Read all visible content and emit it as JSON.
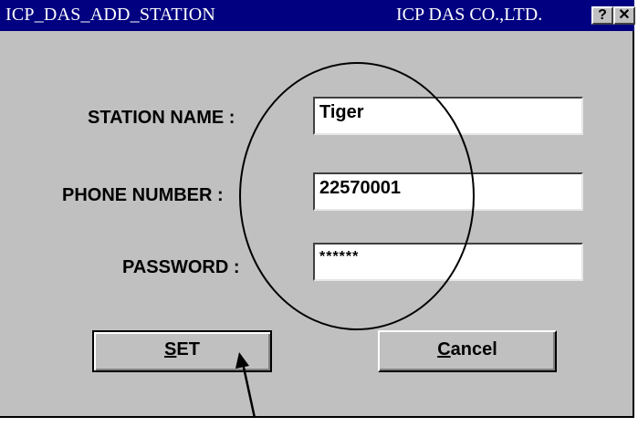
{
  "window": {
    "title": "ICP_DAS_ADD_STATION",
    "company": "ICP DAS CO.,LTD.",
    "help_label": "?",
    "close_label": "✕"
  },
  "form": {
    "station_name_label": "STATION NAME :",
    "station_name_value": "Tiger",
    "phone_number_label": "PHONE NUMBER :",
    "phone_number_value": "22570001",
    "password_label": "PASSWORD :",
    "password_value": "******"
  },
  "buttons": {
    "set_mnemonic": "S",
    "set_rest": "ET",
    "cancel_mnemonic": "C",
    "cancel_rest": "ancel"
  },
  "annotations": {
    "circle_highlight": "input fields",
    "arrow_target": "SET button"
  },
  "colors": {
    "titlebar": "#000080",
    "dialog_bg": "#c0c0c0",
    "field_bg": "#ffffff"
  }
}
